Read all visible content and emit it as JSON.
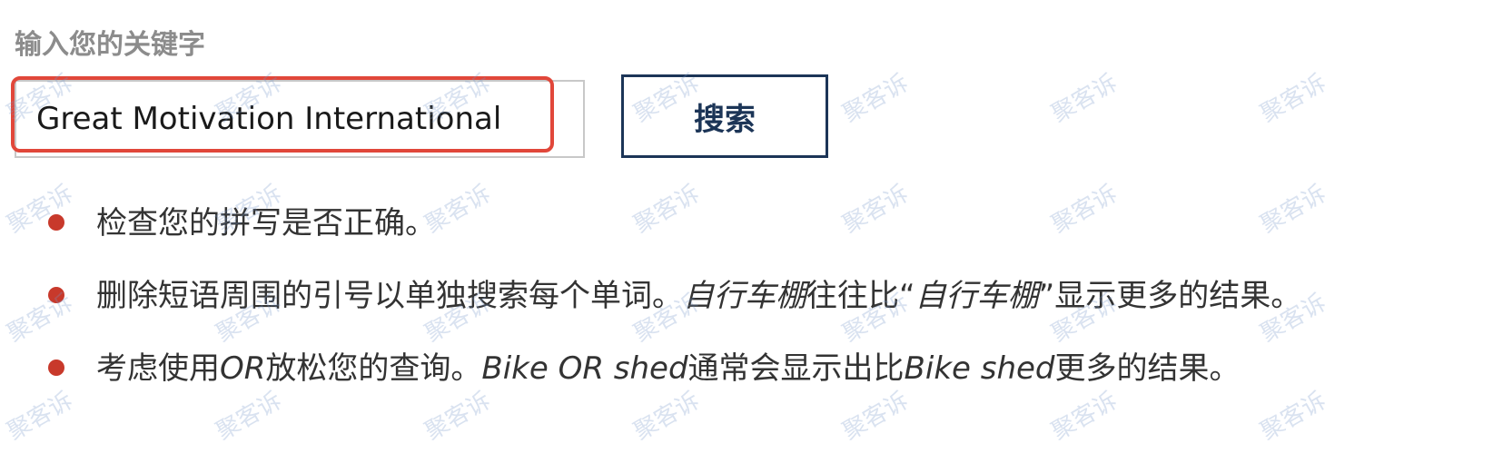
{
  "search": {
    "label": "输入您的关键字",
    "value": "Great Motivation International",
    "button_label": "搜索"
  },
  "tips": {
    "item1": "检查您的拼写是否正确。",
    "item2": {
      "text_a": "删除短语周围的引号以单独搜索每个单词。",
      "em_a": "自行车棚",
      "text_b": "往往比“",
      "em_b": "自行车棚",
      "text_c": "”显示更多的结果。"
    },
    "item3": {
      "text_a": "考虑使用",
      "em_a": "OR",
      "text_b": "放松您的查询。",
      "em_b": "Bike OR shed",
      "text_c": "通常会显示出比",
      "em_c": "Bike shed",
      "text_d": "更多的结果。"
    }
  },
  "watermark": "聚客诉",
  "colors": {
    "focus_ring": "#e1473a",
    "button_border": "#1c3557",
    "bullet": "#c8392b"
  }
}
